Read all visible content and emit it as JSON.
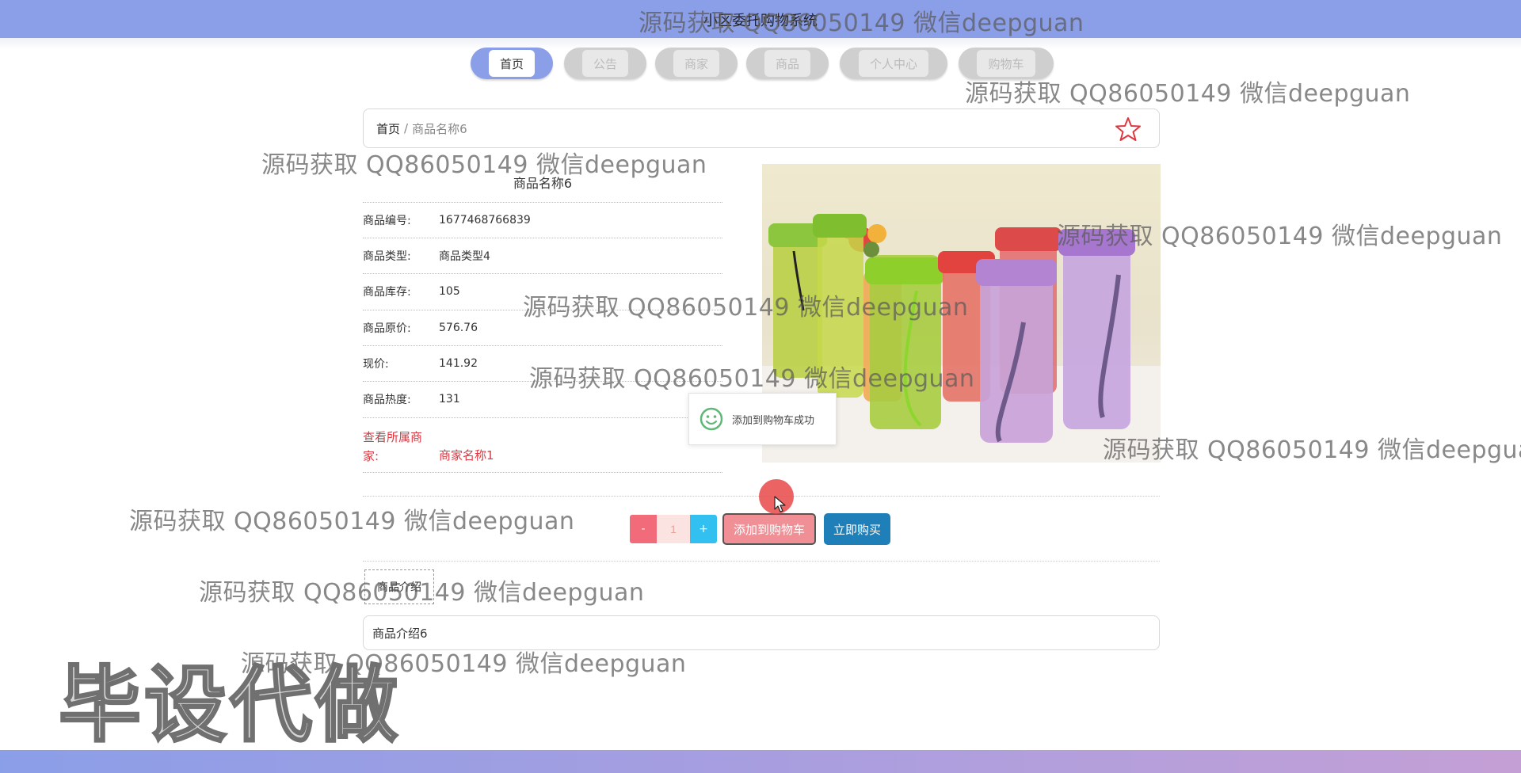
{
  "header": {
    "title": "小区委托购物系统"
  },
  "nav": [
    "首页",
    "公告",
    "商家",
    "商品",
    "个人中心",
    "购物车"
  ],
  "breadcrumb": {
    "home": "首页",
    "separator": "/",
    "current": "商品名称6"
  },
  "product": {
    "name": "商品名称6",
    "fields": [
      {
        "label": "商品编号:",
        "value": "1677468766839"
      },
      {
        "label": "商品类型:",
        "value": "商品类型4"
      },
      {
        "label": "商品库存:",
        "value": "105"
      },
      {
        "label": "商品原价:",
        "value": "576.76"
      },
      {
        "label": "现价:",
        "value": "141.92"
      },
      {
        "label": "商品热度:",
        "value": "131"
      }
    ],
    "merchant_link_label": "查看所属商家:",
    "merchant_name": "商家名称1",
    "image_alt": "彩色塑料水杯"
  },
  "toast": {
    "text": "添加到购物车成功"
  },
  "quantity": {
    "minus": "-",
    "value": "1",
    "plus": "+"
  },
  "buttons": {
    "add_to_cart": "添加到购物车",
    "buy_now": "立即购买"
  },
  "tabs": {
    "intro": "商品介绍"
  },
  "intro": {
    "text": "商品介绍6"
  },
  "watermark": {
    "text": "源码获取 QQ86050149 微信deepguan",
    "big": "毕设代做"
  },
  "colors": {
    "primary": "#8b9ee8",
    "accent_red": "#e0363f",
    "cart_button": "#f08f95",
    "buy_button": "#1f7fb8",
    "plus_button": "#31c0f0"
  }
}
